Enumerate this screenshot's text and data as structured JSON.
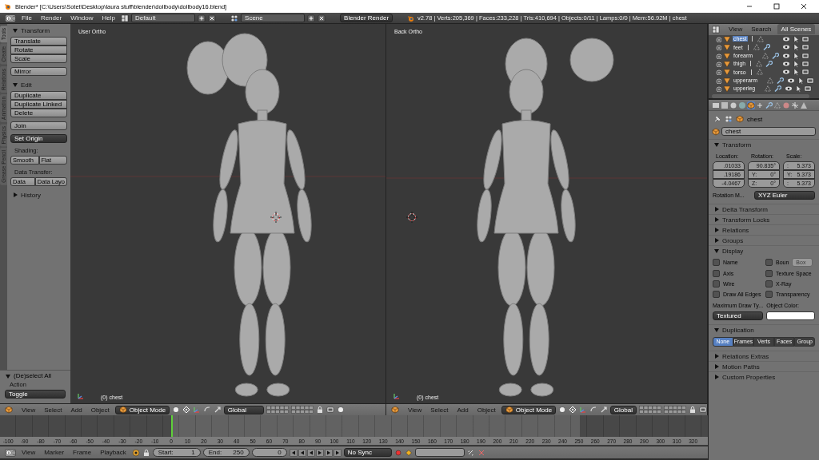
{
  "window": {
    "title": "Blender* [C:\\Users\\Sotet\\Desktop\\laura stuff\\blender\\dollbody\\dollbody16.blend]"
  },
  "info_header": {
    "menus": [
      "File",
      "Render",
      "Window",
      "Help"
    ],
    "layout": "Default",
    "scene": "Scene",
    "engine": "Blender Render",
    "stats": "v2.78 | Verts:205,369 | Faces:233,228 | Tris:410,694 | Objects:0/11 | Lamps:0/0 | Mem:56.92M | chest"
  },
  "toolshelf": {
    "tabs": [
      {
        "label": "Tools",
        "selected": true
      },
      {
        "label": "Create",
        "selected": false
      },
      {
        "label": "Relations",
        "selected": false
      },
      {
        "label": "Animation",
        "selected": false
      },
      {
        "label": "Physics",
        "selected": false
      },
      {
        "label": "Grease Pencil",
        "selected": false
      }
    ],
    "items": [
      {
        "kind": "header",
        "label": "Transform",
        "expanded": true
      },
      {
        "kind": "buttons",
        "labels": [
          "Translate",
          "Rotate",
          "Scale"
        ]
      },
      {
        "kind": "buttons",
        "labels": [
          "Mirror"
        ]
      },
      {
        "kind": "header",
        "label": "Edit",
        "expanded": true
      },
      {
        "kind": "buttons",
        "labels": [
          "Duplicate",
          "Duplicate Linked",
          "Delete"
        ]
      },
      {
        "kind": "buttons",
        "labels": [
          "Join"
        ]
      },
      {
        "kind": "dropdown",
        "label": "Set Origin"
      },
      {
        "kind": "label",
        "label": "Shading:"
      },
      {
        "kind": "row",
        "labels": [
          "Smooth",
          "Flat"
        ]
      },
      {
        "kind": "label",
        "label": "Data Transfer:"
      },
      {
        "kind": "row",
        "labels": [
          "Data",
          "Data Layo"
        ]
      },
      {
        "kind": "header",
        "label": "History",
        "expanded": false
      }
    ],
    "operator": {
      "title": "(De)select All",
      "expanded": true,
      "field_label": "Action",
      "value": "Toggle"
    }
  },
  "viewports": [
    {
      "view": "User Ortho",
      "object": "(0) chest"
    },
    {
      "view": "Back Ortho",
      "object": "(0) chest"
    }
  ],
  "viewport_headers": [
    {
      "menus": [
        "View",
        "Select",
        "Add",
        "Object"
      ],
      "mode": "Object Mode",
      "orientation": "Global"
    },
    {
      "menus": [
        "View",
        "Select",
        "Add",
        "Object"
      ],
      "mode": "Object Mode",
      "orientation": "Global"
    }
  ],
  "timeline": {
    "ruler": [
      "-100",
      "-90",
      "-80",
      "-70",
      "-60",
      "-50",
      "-40",
      "-30",
      "-20",
      "-10",
      "0",
      "10",
      "20",
      "30",
      "40",
      "50",
      "60",
      "70",
      "80",
      "90",
      "100",
      "110",
      "120",
      "130",
      "140",
      "150",
      "160",
      "170",
      "180",
      "190",
      "200",
      "210",
      "220",
      "230",
      "240",
      "250",
      "260",
      "270",
      "280",
      "290",
      "300",
      "310",
      "320"
    ],
    "menus": [
      "View",
      "Marker",
      "Frame",
      "Playback"
    ],
    "start_label": "Start:",
    "start": "1",
    "end_label": "End:",
    "end": "250",
    "current": "0",
    "sync": "No Sync"
  },
  "outliner": {
    "menus": [
      "View",
      "Search"
    ],
    "filter": "All Scenes",
    "items": [
      {
        "name": "chest",
        "selected": true,
        "has_modifier": false
      },
      {
        "name": "feet",
        "selected": false,
        "has_modifier": true
      },
      {
        "name": "forearm",
        "selected": false,
        "has_modifier": true
      },
      {
        "name": "thigh",
        "selected": false,
        "has_modifier": true
      },
      {
        "name": "torso",
        "selected": false,
        "has_modifier": false
      },
      {
        "name": "upperarm",
        "selected": false,
        "has_modifier": true
      },
      {
        "name": "upperleg",
        "selected": false,
        "has_modifier": true
      }
    ]
  },
  "properties": {
    "context_tabs": [
      {
        "selected": false
      },
      {
        "selected": false
      },
      {
        "selected": false
      },
      {
        "selected": false
      },
      {
        "selected": true
      },
      {
        "selected": false
      },
      {
        "selected": false
      },
      {
        "selected": false
      },
      {
        "selected": false
      },
      {
        "selected": false
      },
      {
        "selected": false
      }
    ],
    "path": "chest",
    "object_name": "chest",
    "panels": [
      {
        "title": "Transform",
        "expanded": true,
        "kind": "transform",
        "columns": [
          {
            "label": "Location:",
            "fields": [
              {
                "value": ".01033"
              },
              {
                "value": ".19186"
              },
              {
                "value": "-4.0467"
              }
            ]
          },
          {
            "label": "Rotation:",
            "fields": [
              {
                "value": "90.835°"
              },
              {
                "label": "Y:",
                "value": "0°"
              },
              {
                "label": "Z:",
                "value": "0°"
              }
            ]
          },
          {
            "label": "Scale:",
            "fields": [
              {
                "label": ":",
                "value": "5.373"
              },
              {
                "label": "Y:",
                "value": "5.373"
              },
              {
                "label": ":",
                "value": "5.373"
              }
            ]
          }
        ],
        "mode_label": "Rotation M...",
        "mode": "XYZ Euler"
      },
      {
        "title": "Delta Transform",
        "expanded": false
      },
      {
        "title": "Transform Locks",
        "expanded": false
      },
      {
        "title": "Relations",
        "expanded": false
      },
      {
        "title": "Groups",
        "expanded": false
      },
      {
        "title": "Display",
        "expanded": true,
        "kind": "display",
        "options": [
          {
            "label": "Name",
            "checked": false
          },
          {
            "label": "Boun",
            "checked": false,
            "dropdown": "Box",
            "disabled": true
          },
          {
            "label": "Axis",
            "checked": false
          },
          {
            "label": "Texture Space",
            "checked": false
          },
          {
            "label": "Wire",
            "checked": false
          },
          {
            "label": "X-Ray",
            "checked": false
          },
          {
            "label": "Draw All Edges",
            "checked": false
          },
          {
            "label": "Transparency",
            "checked": false
          }
        ],
        "draw_type_label": "Maximum Draw Ty...",
        "draw_type": "Textured",
        "color_label": "Object Color:"
      },
      {
        "title": "Duplication",
        "expanded": true,
        "kind": "duplication",
        "options": [
          {
            "label": "None",
            "selected": true
          },
          {
            "label": "Frames",
            "selected": false
          },
          {
            "label": "Verts",
            "selected": false
          },
          {
            "label": "Faces",
            "selected": false
          },
          {
            "label": "Group",
            "selected": false
          }
        ]
      },
      {
        "title": "Relations Extras",
        "expanded": false
      },
      {
        "title": "Motion Paths",
        "expanded": false
      },
      {
        "title": "Custom Properties",
        "expanded": false
      }
    ]
  }
}
